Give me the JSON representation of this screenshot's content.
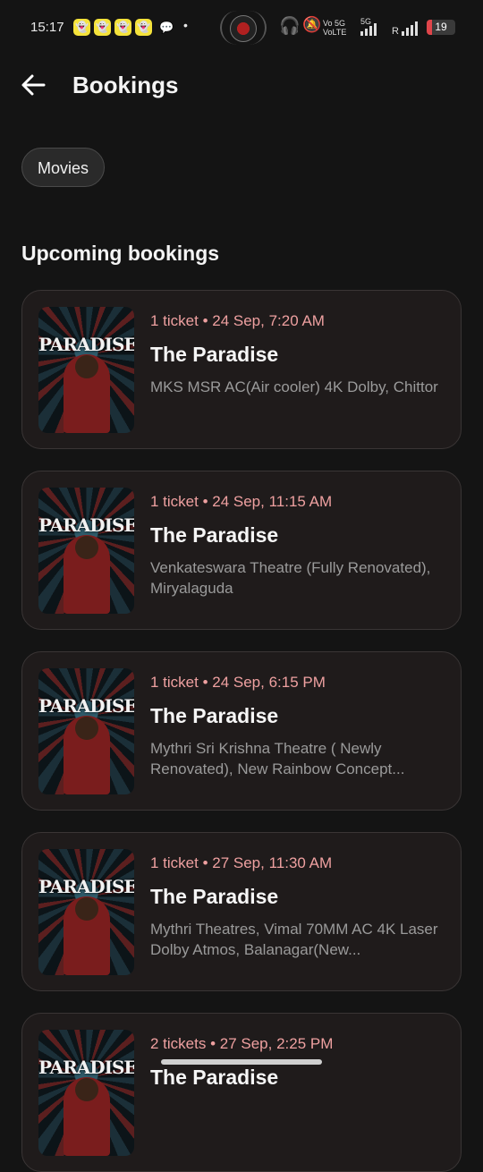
{
  "status_bar": {
    "time": "15:17",
    "network": "Vo 5G VoLTE",
    "signal_5g": "5G",
    "roaming": "R",
    "battery": "19",
    "battery_level": 0.19,
    "battery_color": "#e0454a"
  },
  "header": {
    "title": "Bookings"
  },
  "filter_chip": "Movies",
  "section_title": "Upcoming bookings",
  "poster_title": "PARADISE",
  "bookings": [
    {
      "meta": "1 ticket • 24 Sep, 7:20 AM",
      "movie": "The Paradise",
      "venue": "MKS MSR AC(Air cooler) 4K Dolby, Chittor"
    },
    {
      "meta": "1 ticket • 24 Sep, 11:15 AM",
      "movie": "The Paradise",
      "venue": "Venkateswara Theatre (Fully Renovated), Miryalaguda"
    },
    {
      "meta": "1 ticket • 24 Sep, 6:15 PM",
      "movie": "The Paradise",
      "venue": "Mythri Sri Krishna Theatre ( Newly Renovated), New Rainbow Concept..."
    },
    {
      "meta": "1 ticket • 27 Sep, 11:30 AM",
      "movie": "The Paradise",
      "venue": "Mythri Theatres, Vimal 70MM AC 4K Laser Dolby Atmos, Balanagar(New..."
    },
    {
      "meta": "2 tickets • 27 Sep, 2:25 PM",
      "movie": "The Paradise",
      "venue": ""
    }
  ],
  "colors": {
    "background": "#141414",
    "meta_text": "#eea0a0",
    "card_bg": "#1f1b1b"
  }
}
